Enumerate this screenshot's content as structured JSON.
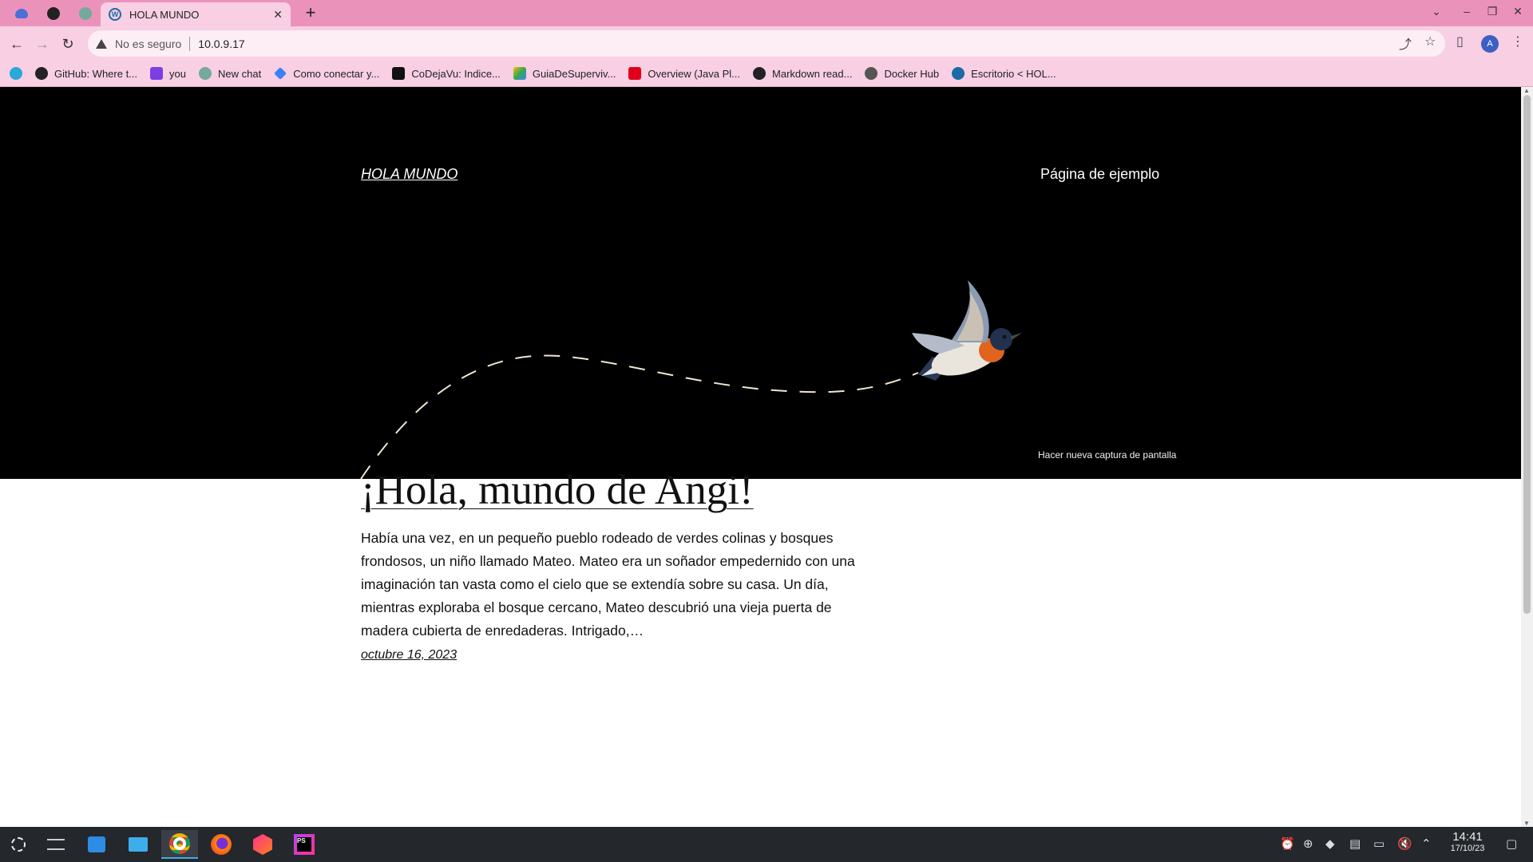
{
  "browser": {
    "active_tab_title": "HOLA MUNDO",
    "new_tab_label": "+",
    "not_secure_label": "No es seguro",
    "url": "10.0.9.17"
  },
  "bookmarks": [
    {
      "label": "GitHub: Where t...",
      "icon": "github-icon",
      "color": "#222222"
    },
    {
      "label": "you",
      "icon": "you-icon",
      "color": "#7b3fe4"
    },
    {
      "label": "New chat",
      "icon": "chatgpt-icon",
      "color": "#74aa9c"
    },
    {
      "label": "Como conectar y...",
      "icon": "link-icon",
      "color": "#3b82f6"
    },
    {
      "label": "CoDejaVu: Indice...",
      "icon": "codejavu-icon",
      "color": "#111111"
    },
    {
      "label": "GuiaDeSuperviv...",
      "icon": "drive-icon",
      "color": "#fbbc04"
    },
    {
      "label": "Overview (Java Pl...",
      "icon": "oracle-icon",
      "color": "#e0001b"
    },
    {
      "label": "Markdown read...",
      "icon": "github-icon",
      "color": "#222222"
    },
    {
      "label": "Docker Hub",
      "icon": "docker-icon",
      "color": "#555555"
    },
    {
      "label": "Escritorio < HOL...",
      "icon": "wordpress-icon",
      "color": "#1b6aa8"
    }
  ],
  "site": {
    "title": "HOLA MUNDO",
    "nav_item": "Página de ejemplo"
  },
  "post": {
    "title": "¡Hola, mundo de Angi!",
    "excerpt": "Había una vez, en un pequeño pueblo rodeado de verdes colinas y bosques frondosos, un niño llamado Mateo. Mateo era un soñador empedernido con una imaginación tan vasta como el cielo que se extendía sobre su casa. Un día, mientras exploraba el bosque cercano, Mateo descubrió una vieja puerta de madera cubierta de enredaderas. Intrigado,…",
    "date": "octubre 16, 2023"
  },
  "faint_overlay": "Hacer nueva captura de pantalla",
  "taskbar": {
    "time": "14:41",
    "date": "17/10/23"
  },
  "colors": {
    "tabbar": "#eb92bb",
    "toolbar": "#f8cfe3",
    "hero_bg": "#000000",
    "taskbar": "#24272c"
  }
}
